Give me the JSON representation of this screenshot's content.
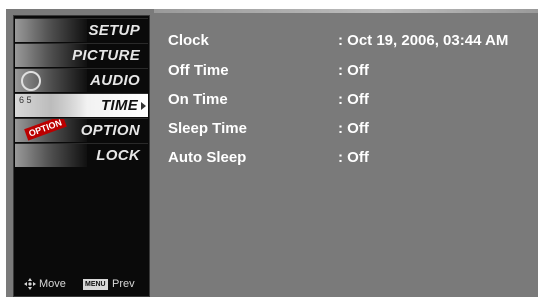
{
  "sidebar": {
    "items": [
      {
        "label": "SETUP",
        "selected": false,
        "icon": "satellite-dish-icon"
      },
      {
        "label": "PICTURE",
        "selected": false,
        "icon": "picture-icon"
      },
      {
        "label": "AUDIO",
        "selected": false,
        "icon": "speaker-icon"
      },
      {
        "label": "TIME",
        "selected": true,
        "icon": "clock-icon"
      },
      {
        "label": "OPTION",
        "selected": false,
        "icon": "option-badge-icon"
      },
      {
        "label": "LOCK",
        "selected": false,
        "icon": "lock-icon"
      }
    ]
  },
  "deco": {
    "time_digits": "6  5",
    "option_badge": "OPTION"
  },
  "footer": {
    "move_label": "Move",
    "menu_key": "MENU",
    "prev_label": "Prev"
  },
  "settings": [
    {
      "key": "Clock",
      "value": ": Oct 19, 2006, 03:44 AM"
    },
    {
      "key": "Off Time",
      "value": ": Off"
    },
    {
      "key": "On Time",
      "value": ": Off"
    },
    {
      "key": "Sleep Time",
      "value": ": Off"
    },
    {
      "key": "Auto Sleep",
      "value": ": Off"
    }
  ],
  "colors": {
    "panel_bg": "#7a7a7a",
    "sidebar_bg": "#0a0a0a",
    "text": "#ffffff"
  }
}
